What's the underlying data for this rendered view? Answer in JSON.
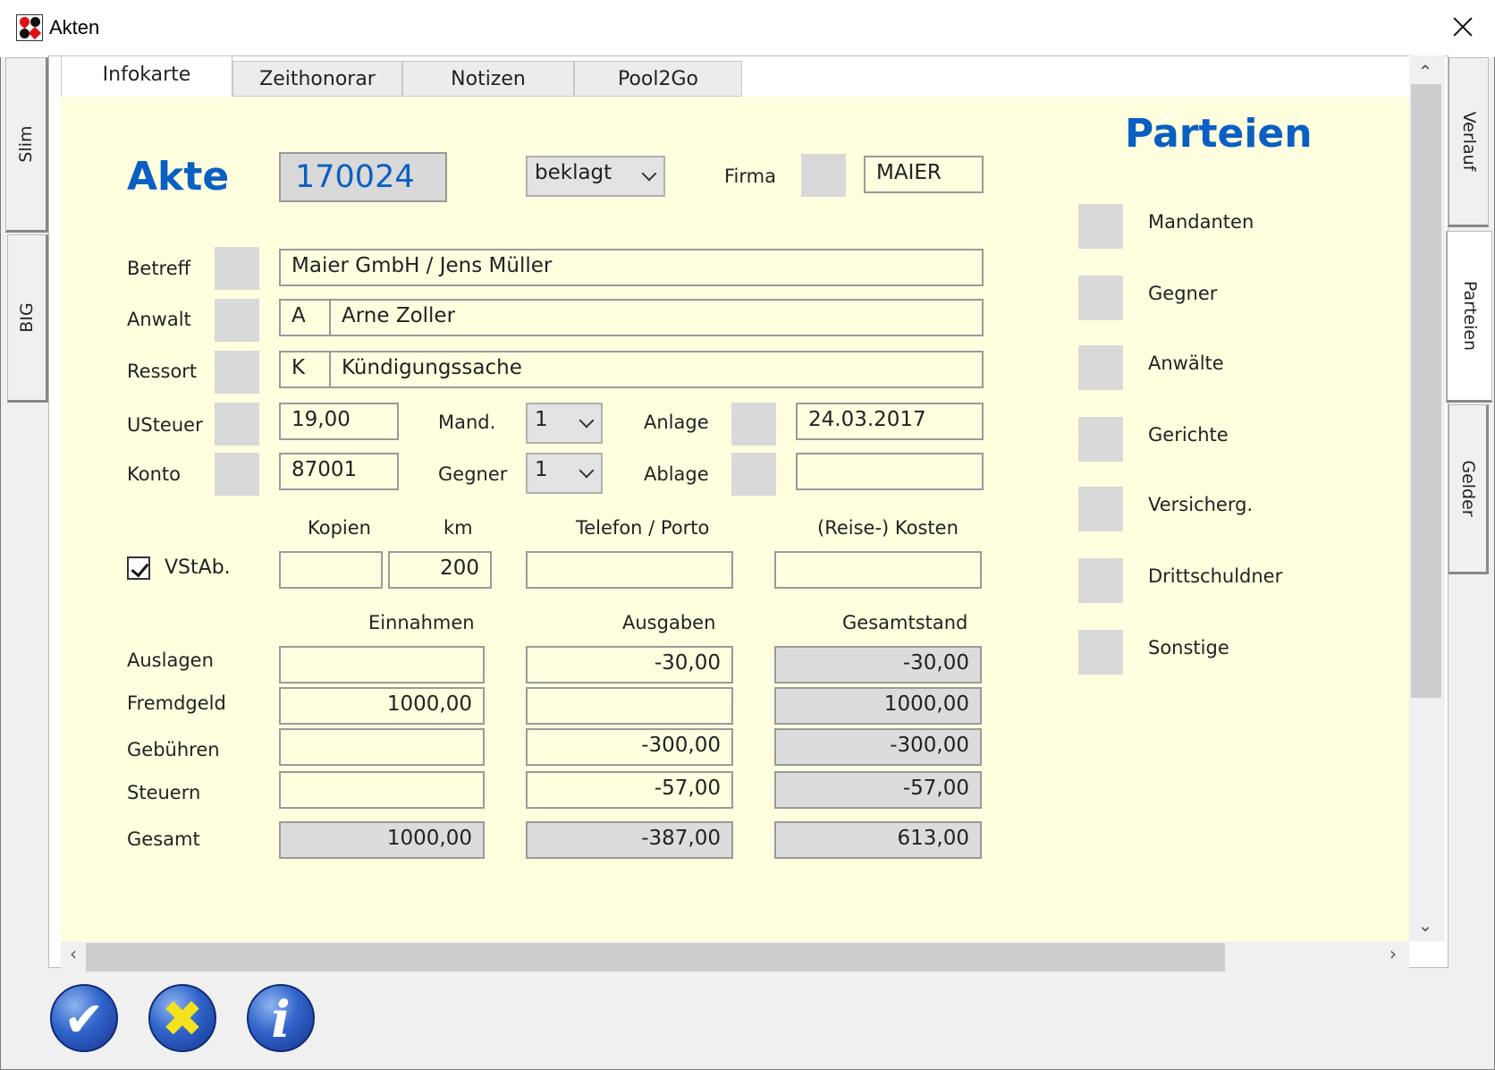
{
  "window": {
    "title": "Akten"
  },
  "left_tabs": [
    "Slim",
    "BIG"
  ],
  "right_tabs": [
    "Verlauf",
    "Parteien",
    "Gelder"
  ],
  "top_tabs": [
    "Infokarte",
    "Zeithonorar",
    "Notizen",
    "Pool2Go"
  ],
  "akte": {
    "heading": "Akte",
    "number": "170024",
    "status_select": "beklagt",
    "firma_label": "Firma",
    "firma_value": "MAIER"
  },
  "form": {
    "betreff_label": "Betreff",
    "betreff_value": "Maier GmbH / Jens Müller",
    "anwalt_label": "Anwalt",
    "anwalt_code": "A",
    "anwalt_name": "Arne Zoller",
    "ressort_label": "Ressort",
    "ressort_code": "K",
    "ressort_name": "Kündigungssache",
    "usteuer_label": "USteuer",
    "usteuer_value": "19,00",
    "mand_label": "Mand.",
    "mand_value": "1",
    "anlage_label": "Anlage",
    "anlage_value": "24.03.2017",
    "konto_label": "Konto",
    "konto_value": "87001",
    "gegner_label": "Gegner",
    "gegner_value": "1",
    "ablage_label": "Ablage",
    "ablage_value": ""
  },
  "costs": {
    "vstab_label": "VStAb.",
    "vstab_checked": true,
    "kopien_label": "Kopien",
    "kopien_value": "",
    "km_label": "km",
    "km_value": "200",
    "telefon_label": "Telefon / Porto",
    "telefon_value": "",
    "reise_label": "(Reise-) Kosten",
    "reise_value": ""
  },
  "finance": {
    "headers": [
      "Einnahmen",
      "Ausgaben",
      "Gesamtstand"
    ],
    "rows": [
      {
        "label": "Auslagen",
        "einnahmen": "",
        "ausgaben": "-30,00",
        "gesamt": "-30,00"
      },
      {
        "label": "Fremdgeld",
        "einnahmen": "1000,00",
        "ausgaben": "",
        "gesamt": "1000,00"
      },
      {
        "label": "Gebühren",
        "einnahmen": "",
        "ausgaben": "-300,00",
        "gesamt": "-300,00"
      },
      {
        "label": "Steuern",
        "einnahmen": "",
        "ausgaben": "-57,00",
        "gesamt": "-57,00"
      },
      {
        "label": "Gesamt",
        "einnahmen": "1000,00",
        "ausgaben": "-387,00",
        "gesamt": "613,00"
      }
    ]
  },
  "parteien": {
    "heading": "Parteien",
    "items": [
      "Mandanten",
      "Gegner",
      "Anwälte",
      "Gerichte",
      "Versicherg.",
      "Drittschuldner",
      "Sonstige"
    ]
  },
  "colors": {
    "accent_blue": "#0a5fc2",
    "form_background": "#ffffe0"
  }
}
